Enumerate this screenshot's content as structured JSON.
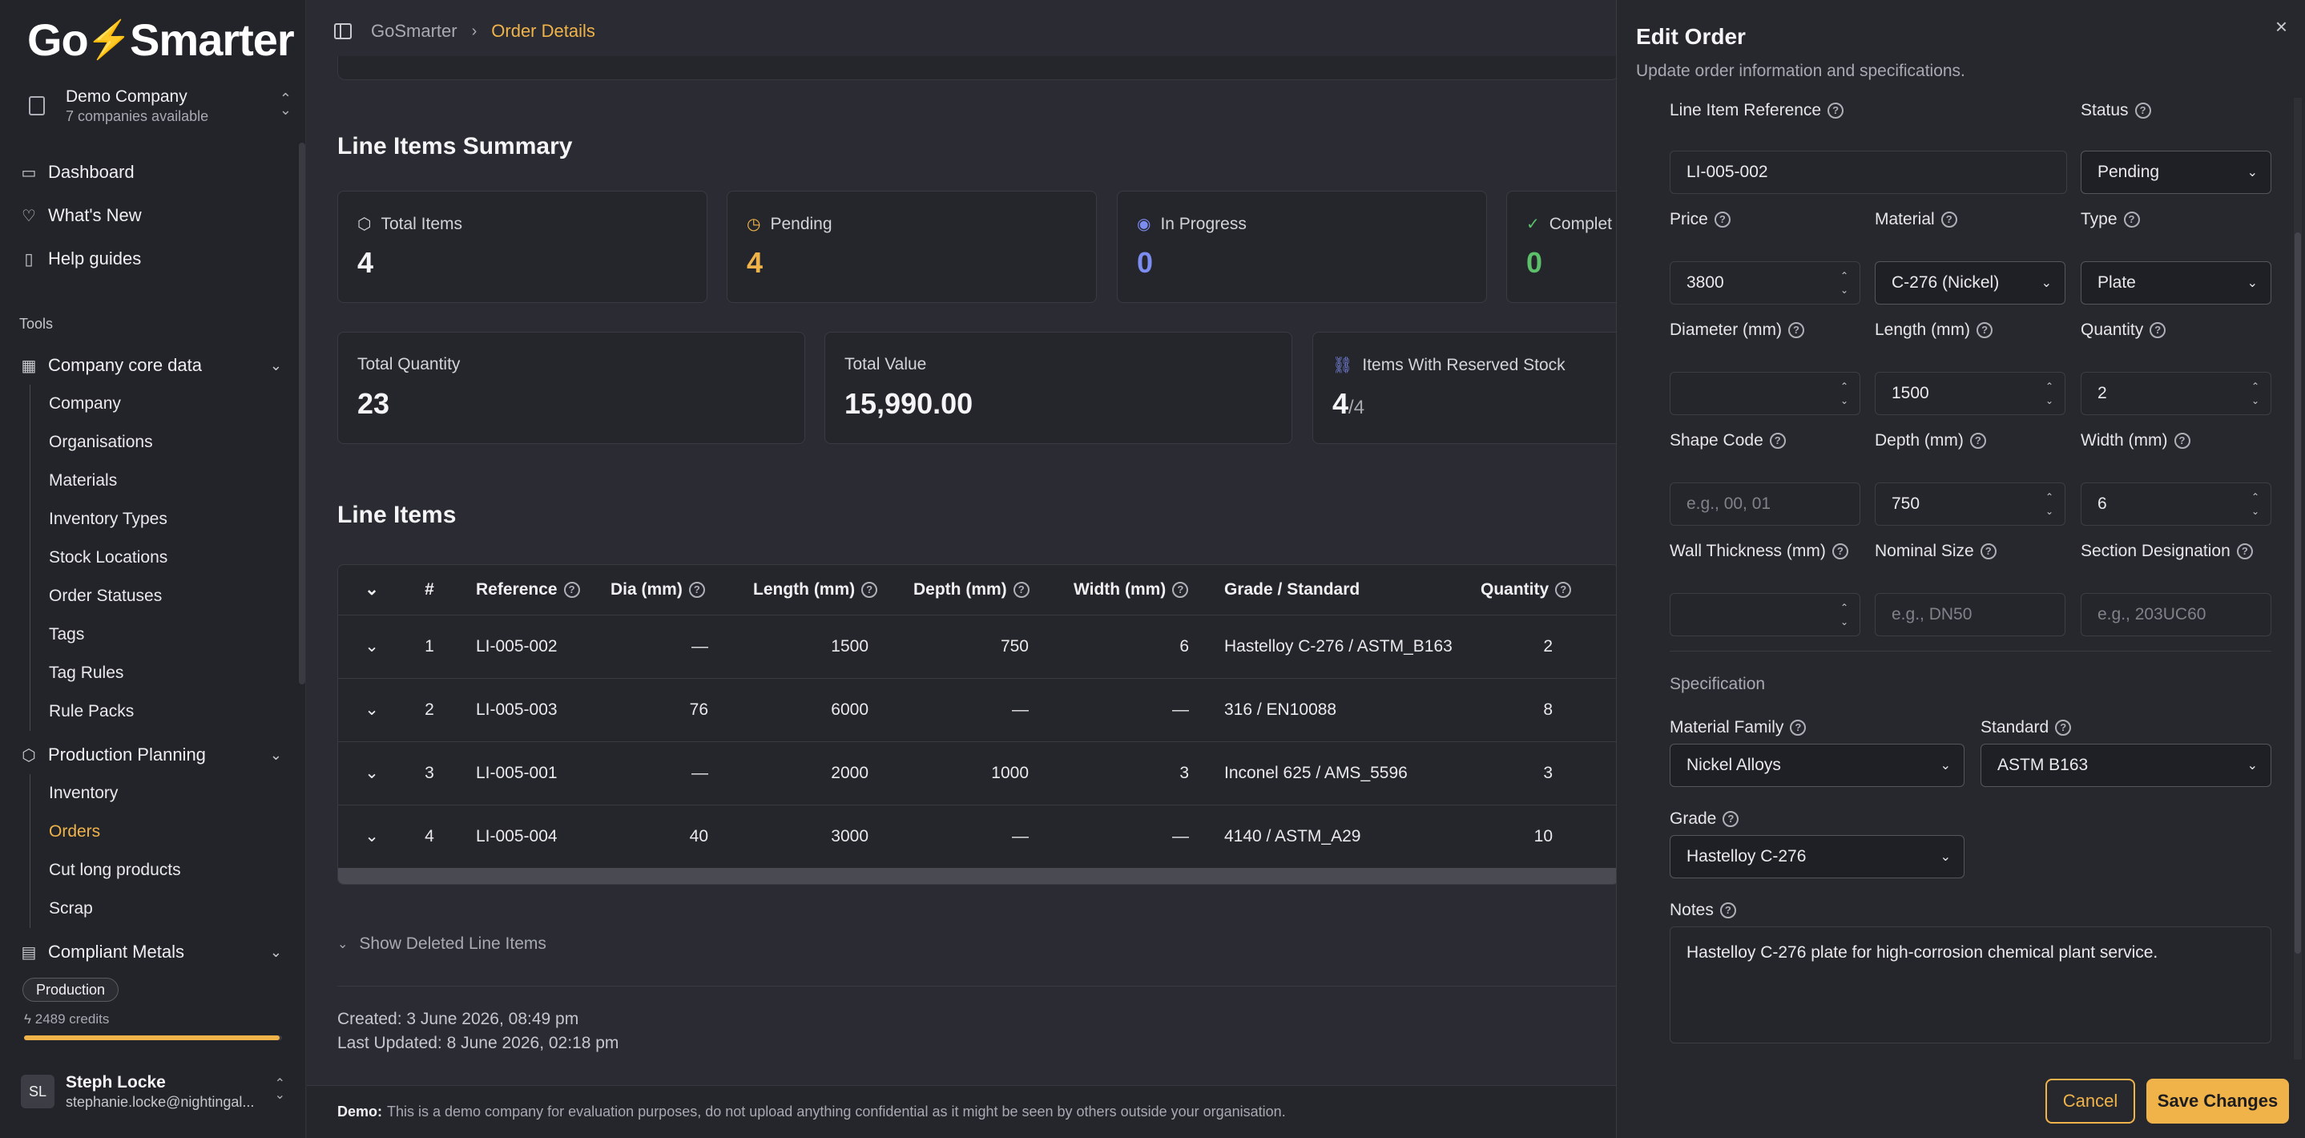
{
  "brand": {
    "logo_left": "Go",
    "logo_right": "Smarter"
  },
  "company": {
    "name": "Demo Company",
    "sub": "7 companies available"
  },
  "nav": {
    "dashboard": "Dashboard",
    "whats_new": "What's New",
    "help_guides": "Help guides",
    "tools_label": "Tools",
    "core_data": "Company core data",
    "core_items": [
      "Company",
      "Organisations",
      "Materials",
      "Inventory Types",
      "Stock Locations",
      "Order Statuses",
      "Tags",
      "Tag Rules",
      "Rule Packs"
    ],
    "production_planning": "Production Planning",
    "pp_items": [
      "Inventory",
      "Orders",
      "Cut long products",
      "Scrap"
    ],
    "compliant_metals": "Compliant Metals"
  },
  "plan": {
    "badge": "Production",
    "credits": "2489 credits",
    "credit_fraction": 0.99
  },
  "user": {
    "initials": "SL",
    "name": "Steph Locke",
    "email": "stephanie.locke@nightingal..."
  },
  "breadcrumb": {
    "root": "GoSmarter",
    "current": "Order Details"
  },
  "summary": {
    "title": "Line Items Summary",
    "total_items_label": "Total Items",
    "total_items": "4",
    "pending_label": "Pending",
    "pending": "4",
    "in_progress_label": "In Progress",
    "in_progress": "0",
    "completed_label": "Complet",
    "completed": "0",
    "total_qty_label": "Total Quantity",
    "total_qty": "23",
    "total_value_label": "Total Value",
    "total_value": "15,990.00",
    "reserved_label": "Items With Reserved Stock",
    "reserved": "4",
    "reserved_total": "/4"
  },
  "line_items": {
    "title": "Line Items",
    "headers": {
      "num": "#",
      "ref": "Reference",
      "dia": "Dia (mm)",
      "len": "Length (mm)",
      "depth": "Depth (mm)",
      "width": "Width (mm)",
      "grade": "Grade / Standard",
      "qty": "Quantity"
    },
    "rows": [
      {
        "num": "1",
        "ref": "LI-005-002",
        "dia": "—",
        "len": "1500",
        "depth": "750",
        "width": "6",
        "grade": "Hastelloy C-276 / ASTM_B163",
        "qty": "2"
      },
      {
        "num": "2",
        "ref": "LI-005-003",
        "dia": "76",
        "len": "6000",
        "depth": "—",
        "width": "—",
        "grade": "316 / EN10088",
        "qty": "8"
      },
      {
        "num": "3",
        "ref": "LI-005-001",
        "dia": "—",
        "len": "2000",
        "depth": "1000",
        "width": "3",
        "grade": "Inconel 625 / AMS_5596",
        "qty": "3"
      },
      {
        "num": "4",
        "ref": "LI-005-004",
        "dia": "40",
        "len": "3000",
        "depth": "—",
        "width": "—",
        "grade": "4140 / ASTM_A29",
        "qty": "10"
      }
    ],
    "show_deleted": "Show Deleted Line Items"
  },
  "meta": {
    "created": "Created: 3 June 2026, 08:49 pm",
    "updated": "Last Updated: 8 June 2026, 02:18 pm"
  },
  "demo": {
    "label": "Demo:",
    "text": "This is a demo company for evaluation purposes, do not upload anything confidential as it might be seen by others outside your organisation."
  },
  "drawer": {
    "title": "Edit Order",
    "subtitle": "Update order information and specifications.",
    "line_ref_label": "Line Item Reference",
    "line_ref": "LI-005-002",
    "status_label": "Status",
    "status": "Pending",
    "price_label": "Price",
    "price": "3800",
    "material_label": "Material",
    "material": "C-276 (Nickel)",
    "type_label": "Type",
    "type": "Plate",
    "diameter_label": "Diameter (mm)",
    "diameter": "",
    "length_label": "Length (mm)",
    "length": "1500",
    "quantity_label": "Quantity",
    "quantity": "2",
    "shape_label": "Shape Code",
    "shape_ph": "e.g., 00, 01",
    "depth_label": "Depth (mm)",
    "depth": "750",
    "width_label": "Width (mm)",
    "width": "6",
    "wall_label": "Wall Thickness (mm)",
    "wall": "",
    "nominal_label": "Nominal Size",
    "nominal_ph": "e.g., DN50",
    "section_label": "Section Designation",
    "section_ph": "e.g., 203UC60",
    "spec_label": "Specification",
    "family_label": "Material Family",
    "family": "Nickel Alloys",
    "standard_label": "Standard",
    "standard": "ASTM B163",
    "grade_label": "Grade",
    "grade": "Hastelloy C-276",
    "notes_label": "Notes",
    "notes": "Hastelloy C-276 plate for high-corrosion chemical plant service.",
    "cancel": "Cancel",
    "save": "Save Changes"
  },
  "colors": {
    "accent": "#f0b34a",
    "pending": "#f0b34a",
    "in_progress": "#7c8cf0",
    "completed": "#5cc06a"
  }
}
